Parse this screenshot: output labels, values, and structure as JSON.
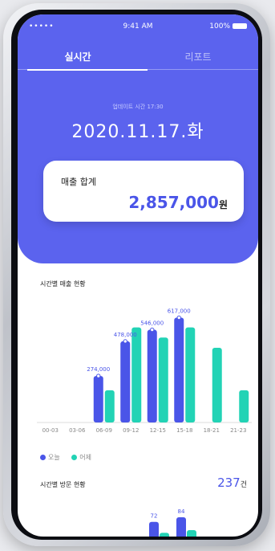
{
  "status_bar": {
    "signal": "•••••",
    "time": "9:41 AM",
    "battery": "100%"
  },
  "tabs": [
    {
      "label": "실시간"
    },
    {
      "label": "리포트"
    }
  ],
  "header": {
    "updated": "업데이트 시간 17:30",
    "date": "2020.11.17.화"
  },
  "summary": {
    "label": "매출 합계",
    "value": "2,857,000",
    "unit": "원"
  },
  "chart_section": {
    "title": "시간별 매출 현황"
  },
  "visits_section": {
    "title": "시간별 방문 현황",
    "value": "237",
    "unit": "건"
  },
  "colors": {
    "accent": "#5b63ee",
    "today": "#4a55e8",
    "yesterday": "#22d3b5"
  },
  "chart_data": {
    "type": "bar",
    "categories": [
      "00-03",
      "03-06",
      "06-09",
      "09-12",
      "12-15",
      "15-18",
      "18-21",
      "21-23"
    ],
    "series": [
      {
        "name": "오늘",
        "values": [
          0,
          0,
          274000,
          478000,
          546000,
          617000,
          null,
          null
        ]
      },
      {
        "name": "어제",
        "values": [
          0,
          0,
          190000,
          560000,
          500000,
          560000,
          440000,
          190000
        ]
      }
    ],
    "data_labels": [
      "",
      "",
      "274,000",
      "478,000",
      "546,000",
      "617,000",
      "",
      ""
    ],
    "ylim": [
      0,
      700000
    ],
    "legend": "bottom-left"
  },
  "visits_chart": {
    "type": "bar",
    "labels": [
      "72",
      "84"
    ],
    "values": [
      72,
      84
    ]
  }
}
